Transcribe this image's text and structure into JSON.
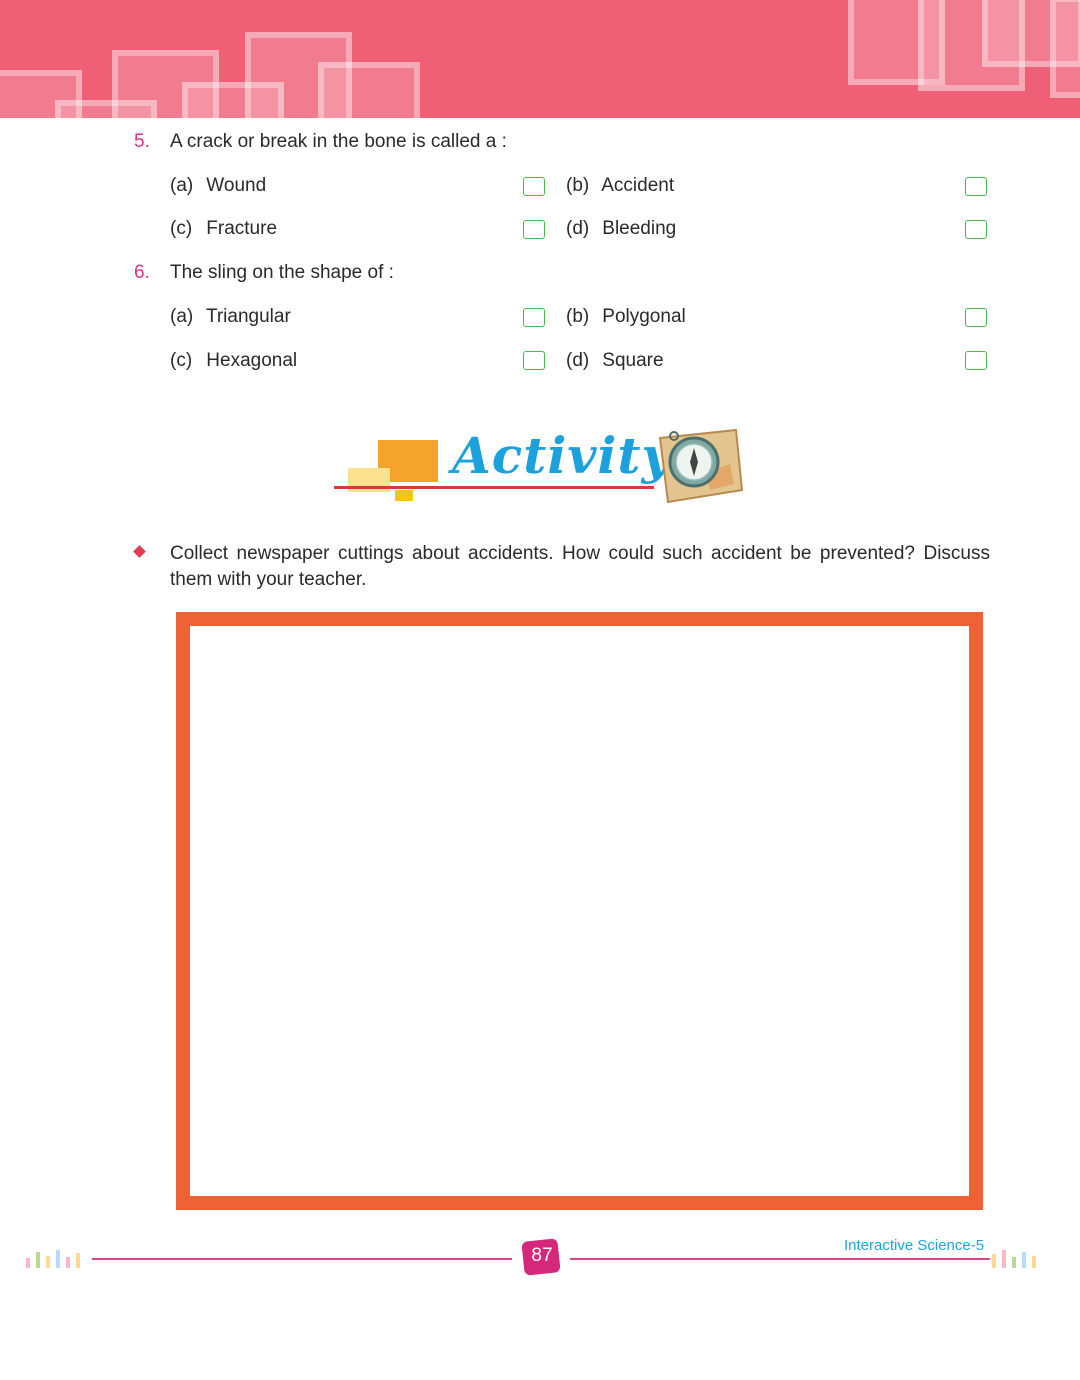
{
  "questions": [
    {
      "number": "5.",
      "text": "A crack or break in the bone is called a :",
      "options": [
        {
          "letter": "(a)",
          "text": "Wound"
        },
        {
          "letter": "(b)",
          "text": "Accident"
        },
        {
          "letter": "(c)",
          "text": "Fracture"
        },
        {
          "letter": "(d)",
          "text": "Bleeding"
        }
      ]
    },
    {
      "number": "6.",
      "text": "The sling on the shape of :",
      "options": [
        {
          "letter": "(a)",
          "text": "Triangular"
        },
        {
          "letter": "(b)",
          "text": "Polygonal"
        },
        {
          "letter": "(c)",
          "text": "Hexagonal"
        },
        {
          "letter": "(d)",
          "text": "Square"
        }
      ]
    }
  ],
  "activity": {
    "title": "Activity",
    "text": "Collect newspaper cuttings about accidents. How could such accident be prevented? Discuss them with your teacher."
  },
  "footer": {
    "page_number": "87",
    "book_title": "Interactive Science-5"
  },
  "colors": {
    "header": "#ef6077",
    "question_number": "#d63384",
    "activity_title": "#1da1dc",
    "answer_box_border": "#ee6236",
    "checkbox_border": "#48b84f",
    "footer_line": "#e0418b",
    "page_badge": "#d6287a",
    "book_title": "#1aa7d9"
  }
}
